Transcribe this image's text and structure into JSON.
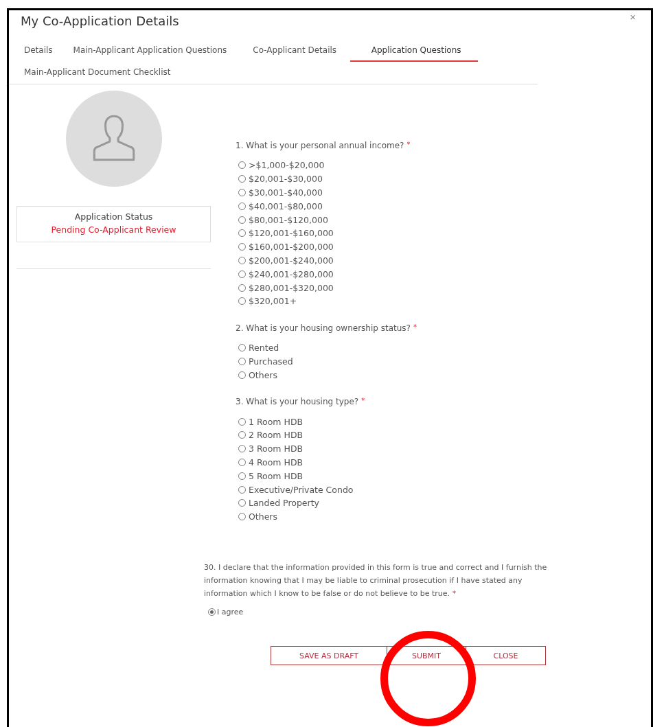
{
  "window": {
    "title": "My Co-Application Details",
    "close": "×"
  },
  "tabs": [
    {
      "label": "Details",
      "selected": false
    },
    {
      "label": "Main-Applicant Application Questions",
      "selected": false
    },
    {
      "label": "Co-Applicant Details",
      "selected": false
    },
    {
      "label": "Application Questions",
      "selected": true
    },
    {
      "label": "Main-Applicant Document Checklist",
      "selected": false
    }
  ],
  "status": {
    "label": "Application Status",
    "value": "Pending Co-Applicant Review"
  },
  "questions": [
    {
      "text": "1. What is your personal annual income?",
      "required": true,
      "options": [
        {
          "label": ">$1,000-$20,000",
          "selected": false
        },
        {
          "label": "$20,001-$30,000",
          "selected": false
        },
        {
          "label": "$30,001-$40,000",
          "selected": false
        },
        {
          "label": "$40,001-$80,000",
          "selected": false
        },
        {
          "label": "$80,001-$120,000",
          "selected": false
        },
        {
          "label": "$120,001-$160,000",
          "selected": false
        },
        {
          "label": "$160,001-$200,000",
          "selected": false
        },
        {
          "label": "$200,001-$240,000",
          "selected": false
        },
        {
          "label": "$240,001-$280,000",
          "selected": false
        },
        {
          "label": "$280,001-$320,000",
          "selected": false
        },
        {
          "label": "$320,001+",
          "selected": false
        }
      ]
    },
    {
      "text": "2. What is your housing ownership status?",
      "required": true,
      "options": [
        {
          "label": "Rented",
          "selected": false
        },
        {
          "label": "Purchased",
          "selected": false
        },
        {
          "label": "Others",
          "selected": false
        }
      ]
    },
    {
      "text": "3. What is your housing type?",
      "required": true,
      "options": [
        {
          "label": "1 Room HDB",
          "selected": false
        },
        {
          "label": "2 Room HDB",
          "selected": false
        },
        {
          "label": "3 Room HDB",
          "selected": false
        },
        {
          "label": "4 Room HDB",
          "selected": false
        },
        {
          "label": "5 Room HDB",
          "selected": false
        },
        {
          "label": "Executive/Private Condo",
          "selected": false
        },
        {
          "label": "Landed Property",
          "selected": false
        },
        {
          "label": "Others",
          "selected": false
        }
      ]
    }
  ],
  "declaration": {
    "text": "30. I declare that the information provided in this form is true and correct and I furnish the information knowing that I may be liable to criminal prosecution if I have stated any information which I know to be false or do not believe to be true.",
    "required": true,
    "options": [
      {
        "label": "I agree",
        "selected": true
      }
    ]
  },
  "required_mark": "*",
  "buttons": [
    "SAVE AS DRAFT",
    "SUBMIT",
    "CLOSE"
  ],
  "annotation": {
    "kind": "circle"
  }
}
